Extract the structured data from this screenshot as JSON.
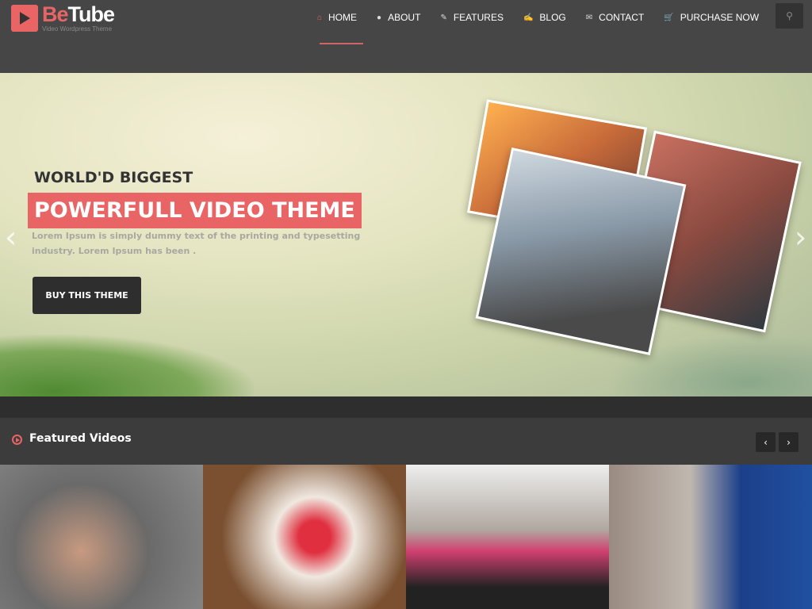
{
  "brand": {
    "name_part1": "Be",
    "name_part2": "Tube",
    "tagline": "Video Wordpress Theme",
    "accent": "#e96565"
  },
  "nav": [
    {
      "label": "HOME",
      "icon": "home-icon",
      "glyph": "⌂",
      "active": true
    },
    {
      "label": "ABOUT",
      "icon": "user-icon",
      "glyph": "●"
    },
    {
      "label": "FEATURES",
      "icon": "magic-wand-icon",
      "glyph": "✎"
    },
    {
      "label": "BLOG",
      "icon": "edit-icon",
      "glyph": "✍"
    },
    {
      "label": "CONTACT",
      "icon": "envelope-icon",
      "glyph": "✉"
    },
    {
      "label": "PURCHASE NOW",
      "icon": "cart-icon",
      "glyph": "🛒"
    }
  ],
  "search": {
    "icon": "search-icon",
    "glyph": "⚲"
  },
  "hero": {
    "kicker": "WORLD'D BIGGEST",
    "headline": "POWERFULL VIDEO THEME",
    "description": "Lorem Ipsum is simply dummy text of the printing and typesetting industry. Lorem Ipsum has been .",
    "button": "BUY THIS THEME",
    "prev": "‹",
    "next": "›"
  },
  "featured": {
    "title": "Featured Videos",
    "prev": "‹",
    "next": "›"
  }
}
